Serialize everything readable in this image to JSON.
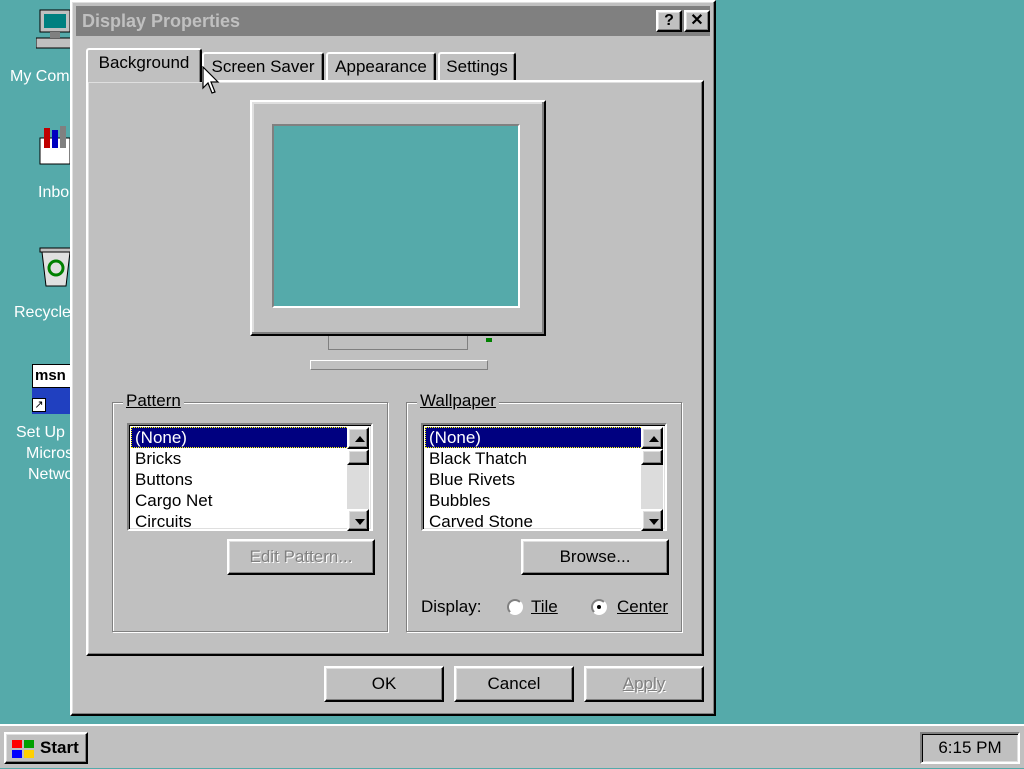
{
  "desktop": {
    "icons": [
      {
        "label_line1": "My Com",
        "label_line2": ""
      },
      {
        "label_line1": "Inbo",
        "label_line2": ""
      },
      {
        "label_line1": "Recycle",
        "label_line2": ""
      },
      {
        "label_line1": "Set Up",
        "label_line2": "Micros",
        "label_line3": "Netwo",
        "logo_text": "msn"
      }
    ]
  },
  "window": {
    "title": "Display Properties",
    "help_button": "?",
    "close_button": "✕",
    "tabs": [
      {
        "label": "Background",
        "active": true
      },
      {
        "label": "Screen Saver",
        "active": false
      },
      {
        "label": "Appearance",
        "active": false
      },
      {
        "label": "Settings",
        "active": false
      }
    ],
    "preview_color": "#55aaaa",
    "pattern": {
      "label": "Pattern",
      "items": [
        "(None)",
        "Bricks",
        "Buttons",
        "Cargo Net",
        "Circuits"
      ],
      "selected": "(None)",
      "edit_button": "Edit Pattern..."
    },
    "wallpaper": {
      "label": "Wallpaper",
      "items": [
        "(None)",
        "Black Thatch",
        "Blue Rivets",
        "Bubbles",
        "Carved Stone"
      ],
      "selected": "(None)",
      "browse_button": "Browse...",
      "display_label": "Display:",
      "display_options": [
        {
          "label": "Tile",
          "checked": false
        },
        {
          "label": "Center",
          "checked": true
        }
      ]
    },
    "buttons": {
      "ok": "OK",
      "cancel": "Cancel",
      "apply": "Apply"
    }
  },
  "taskbar": {
    "start_label": "Start",
    "clock": "6:15 PM"
  },
  "colors": {
    "desktop": "#55aaaa",
    "face": "#c0c0c0",
    "selection": "#000080"
  }
}
